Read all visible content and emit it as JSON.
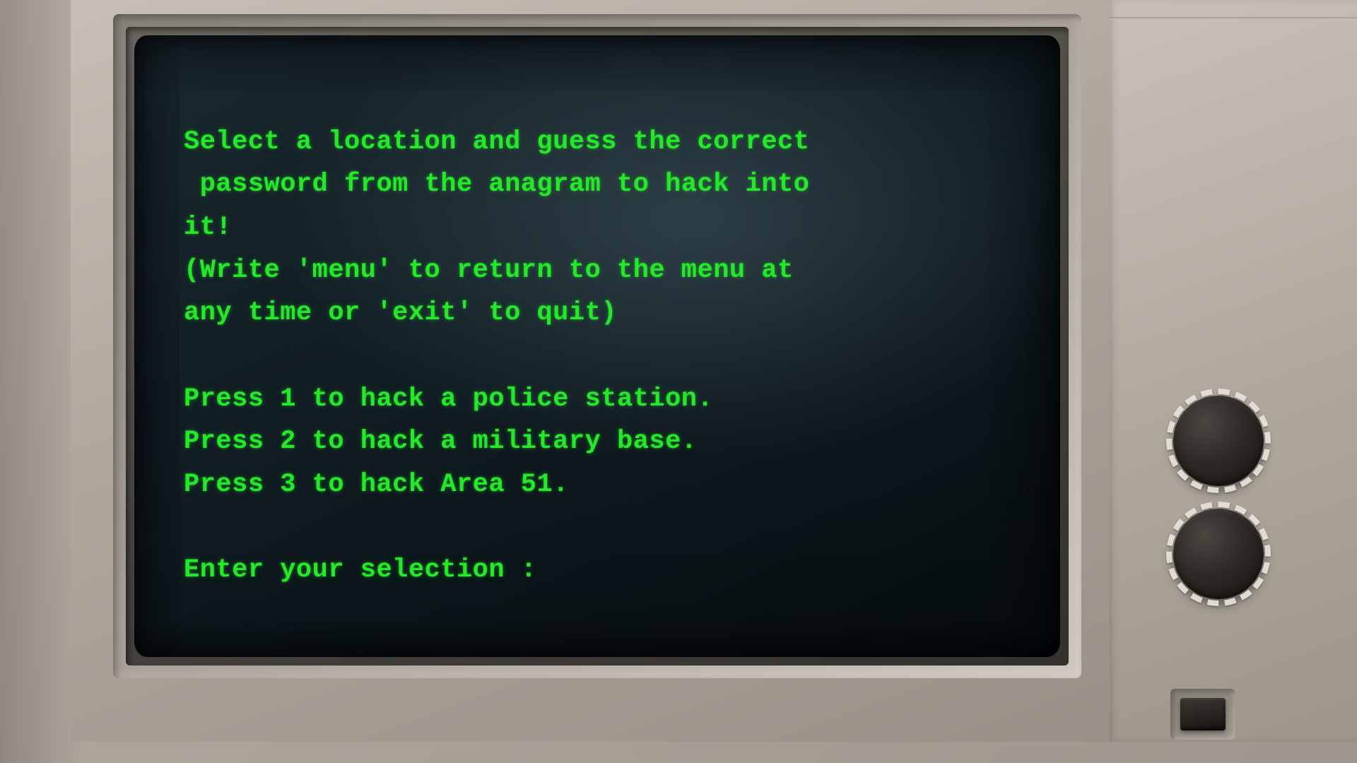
{
  "colors": {
    "text": "#25e82b",
    "screen_bg_dark": "#0a1216"
  },
  "terminal": {
    "line1": "Select a location and guess the correct",
    "line2": " password from the anagram to hack into",
    "line3": "it!",
    "line4": "(Write 'menu' to return to the menu at",
    "line5": "any time or 'exit' to quit)",
    "option1": "Press 1 to hack a police station.",
    "option2": "Press 2 to hack a military base.",
    "option3": "Press 3 to hack Area 51.",
    "prompt": "Enter your selection :"
  }
}
